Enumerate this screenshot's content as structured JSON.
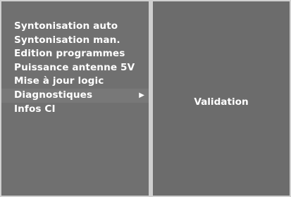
{
  "menu": {
    "items": [
      {
        "label": "Syntonisation auto"
      },
      {
        "label": "Syntonisation man."
      },
      {
        "label": "Edition programmes"
      },
      {
        "label": "Puissance antenne 5V"
      },
      {
        "label": "Mise à jour logic"
      },
      {
        "label": "Diagnostiques",
        "selected": true
      },
      {
        "label": "Infos CI"
      }
    ],
    "arrow_icon": "▶"
  },
  "submenu": {
    "items": [
      {
        "label": "Validation"
      }
    ]
  },
  "colors": {
    "background": "#6e6e6e",
    "divider": "#cfcfcf",
    "text": "#ffffff"
  }
}
